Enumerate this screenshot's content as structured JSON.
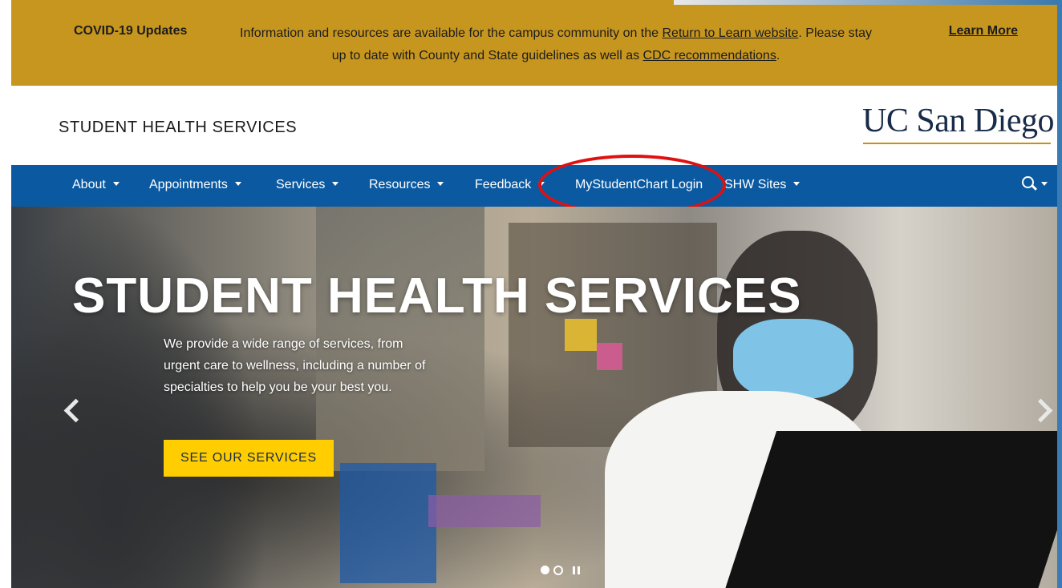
{
  "covid_banner": {
    "title": "COVID-19 Updates",
    "text_1": "Information and resources are available for the campus community on the ",
    "link_1": "Return to Learn website",
    "text_2": ". Please stay up to date with County and State guidelines as well as ",
    "link_2": "CDC recommendations",
    "text_3": ".",
    "learn_more": "Learn More",
    "bg_color": "#c7961f"
  },
  "header": {
    "site_name": "STUDENT HEALTH SERVICES",
    "logo_text": "UC San Diego"
  },
  "nav": {
    "bg_color": "#0b5aa1",
    "items": [
      {
        "label": "About"
      },
      {
        "label": "Appointments"
      },
      {
        "label": "Services"
      },
      {
        "label": "Resources"
      },
      {
        "label": "Feedback"
      },
      {
        "label": "MyStudentChart Login"
      },
      {
        "label": "SHW Sites"
      }
    ],
    "search_icon": "search-icon",
    "highlight_color": "#e01010"
  },
  "hero": {
    "title": "STUDENT HEALTH SERVICES",
    "description": "We provide a wide range of services, from urgent care to wellness, including a number of specialties to help you be your best you.",
    "cta_label": "SEE OUR SERVICES",
    "cta_color": "#ffcd00",
    "prev_icon": "chevron-left-icon",
    "next_icon": "chevron-right-icon"
  }
}
